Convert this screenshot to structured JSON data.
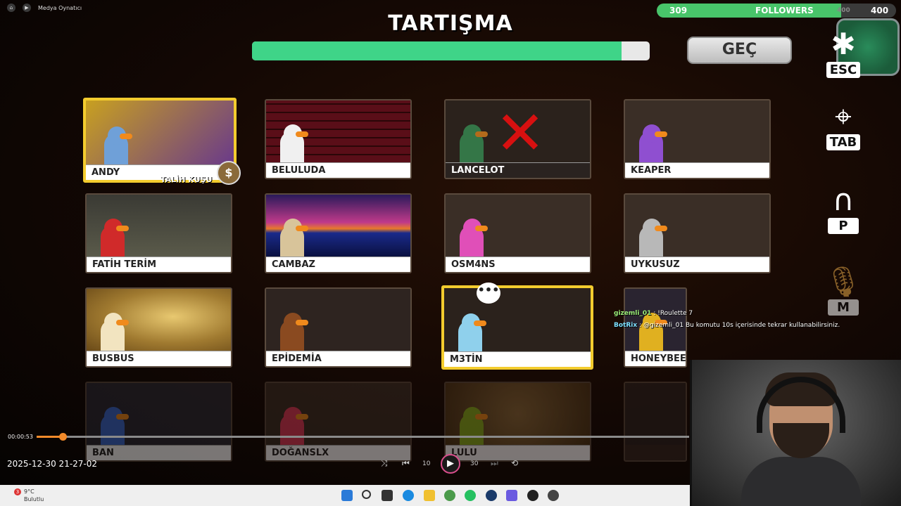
{
  "window": {
    "app_title": "Medya Oynatıcı"
  },
  "game": {
    "phase_title": "TARTIŞMA",
    "timer_fraction": 0.93,
    "skip_label": "GEÇ",
    "followers": {
      "current": "309",
      "label": "FOLLOWERS",
      "goal_faded": "400",
      "goal": "400",
      "fraction": 0.77
    },
    "controls": [
      {
        "key": "ESC",
        "icon": "settings-gear-icon"
      },
      {
        "key": "TAB",
        "icon": "map-icon"
      },
      {
        "key": "P",
        "icon": "headphones-icon"
      },
      {
        "key": "M",
        "icon": "microphone-icon"
      }
    ],
    "talih_label": "TALİH KUŞU",
    "coin_symbol": "$",
    "speech_symbol": "•••",
    "players": [
      {
        "name": "ANDY",
        "color": "#6fa0d8",
        "state": "active"
      },
      {
        "name": "BELULUDA",
        "color": "#f0f0f0",
        "state": "normal"
      },
      {
        "name": "LANCELOT",
        "color": "#3a9a5a",
        "state": "dead"
      },
      {
        "name": "KEAPER",
        "color": "#8f4fd0",
        "state": "normal"
      },
      {
        "name": "FATİH TERİM",
        "color": "#d02a2a",
        "state": "normal"
      },
      {
        "name": "CAMBAZ",
        "color": "#d8c49a",
        "state": "normal"
      },
      {
        "name": "OSM4NS",
        "color": "#e04fb8",
        "state": "normal"
      },
      {
        "name": "UYKUSUZ",
        "color": "#b8b8b8",
        "state": "normal"
      },
      {
        "name": "BUSBUS",
        "color": "#f2e4c0",
        "state": "normal"
      },
      {
        "name": "EPİDEMİA",
        "color": "#8a4a20",
        "state": "normal"
      },
      {
        "name": "M3TİN",
        "color": "#8fd0ec",
        "state": "talking"
      },
      {
        "name": "HONEYBEE",
        "color": "#e0b020",
        "state": "normal"
      },
      {
        "name": "BAN",
        "color": "#3a6ad0",
        "state": "faded"
      },
      {
        "name": "DOĞANSLX",
        "color": "#e03a5a",
        "state": "faded"
      },
      {
        "name": "LULU",
        "color": "#8ab020",
        "state": "faded"
      }
    ]
  },
  "chat": [
    {
      "user": "gizemli_01",
      "text": "!Roulette 7"
    },
    {
      "user": "BotRix",
      "text": "@gizemli_01 Bu komutu 10s içerisinde tekrar kullanabilirsiniz."
    }
  ],
  "player": {
    "elapsed": "00:00:53",
    "progress_fraction": 0.04,
    "recording_timestamp": "2025-12-30 21-27-02",
    "skip_back_label": "10",
    "skip_fwd_label": "30"
  },
  "taskbar": {
    "weather_badge": "3",
    "temperature": "9°C",
    "condition": "Bulutlu"
  }
}
